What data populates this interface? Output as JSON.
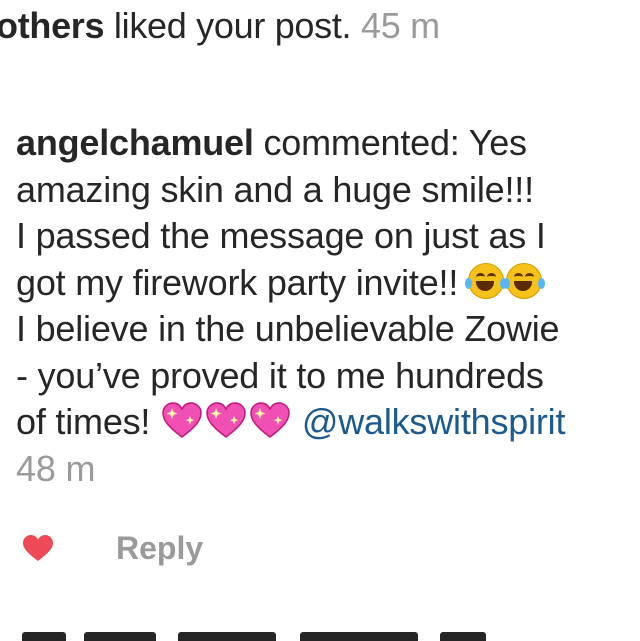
{
  "notification": {
    "actor_bold": "others",
    "text": " liked your post.",
    "time": "45 m"
  },
  "comment": {
    "username": "angelchamuel",
    "lines": [
      " commented: Yes",
      "amazing skin and a huge smile!!!",
      "I passed the message on just as I",
      "got my firework party invite!! ",
      "I believe in the unbelievable Zowie",
      "- you’ve proved it to me hundreds",
      "of times! "
    ],
    "mention": "@walkswithspirit",
    "time": "48 m",
    "emojis": [
      "face-with-tears-of-joy",
      "face-with-tears-of-joy",
      "sparkling-heart",
      "sparkling-heart",
      "sparkling-heart"
    ]
  },
  "actions": {
    "like_icon": "heart-icon",
    "like_color": "#ed4956",
    "reply_label": "Reply"
  },
  "colors": {
    "text": "#262626",
    "muted": "#9a9a9a",
    "mention": "#1b5a8f"
  }
}
